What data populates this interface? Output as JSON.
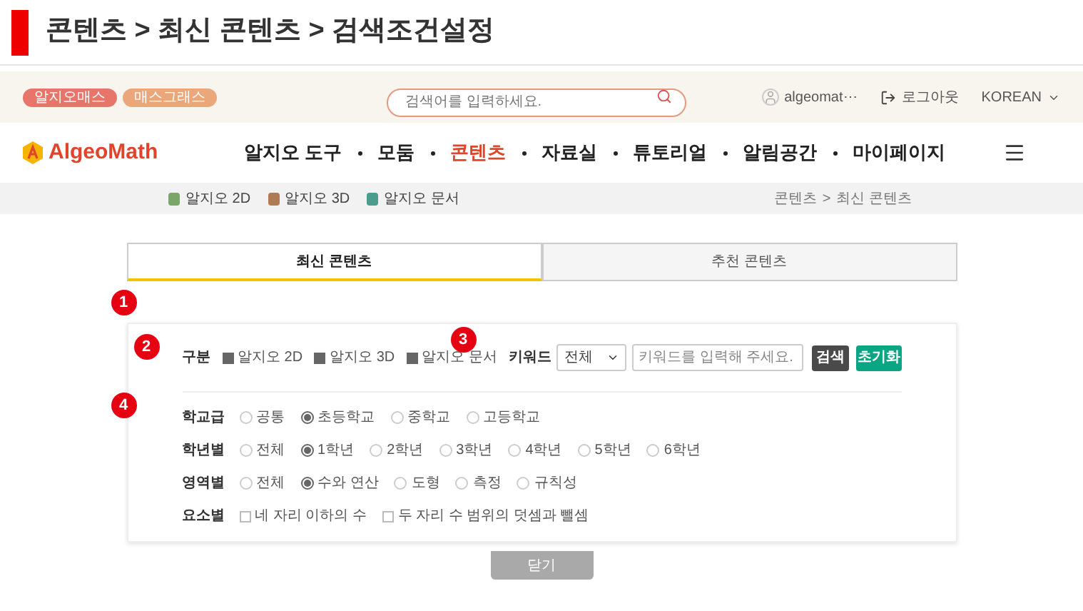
{
  "page_title": "콘텐츠 > 최신 콘텐츠 > 검색조건설정",
  "top_bar": {
    "pills": [
      {
        "label": "알지오매스",
        "color": "#e8756a"
      },
      {
        "label": "매스그래스",
        "color": "#eba77a"
      }
    ],
    "search": {
      "placeholder": "검색어를 입력하세요."
    },
    "user": "algeomat⋯",
    "logout": "로그아웃",
    "language": "KOREAN"
  },
  "nav": {
    "logo": "AlgeoMath",
    "items": [
      {
        "label": "알지오 도구",
        "selected": false
      },
      {
        "label": "모둠",
        "selected": false
      },
      {
        "label": "콘텐츠",
        "selected": true
      },
      {
        "label": "자료실",
        "selected": false
      },
      {
        "label": "튜토리얼",
        "selected": false
      },
      {
        "label": "알림공간",
        "selected": false
      },
      {
        "label": "마이페이지",
        "selected": false
      }
    ]
  },
  "sub_nav": {
    "links": [
      "알지오 2D",
      "알지오 3D",
      "알지오 문서"
    ],
    "breadcrumb": [
      "콘텐츠",
      ">",
      "최신 콘텐츠"
    ]
  },
  "tabs": [
    {
      "label": "최신 콘텐츠",
      "selected": true
    },
    {
      "label": "추천 콘텐츠",
      "selected": false
    }
  ],
  "markers": [
    "1",
    "2",
    "3",
    "4"
  ],
  "filter": {
    "category": {
      "label": "구분",
      "options": [
        {
          "label": "알지오 2D",
          "checked": true
        },
        {
          "label": "알지오 3D",
          "checked": true
        },
        {
          "label": "알지오 문서",
          "checked": true
        }
      ]
    },
    "keyword": {
      "label": "키워드",
      "select": "전체",
      "placeholder": "키워드를 입력해 주세요.",
      "search_button": "검색",
      "reset_button": "초기화"
    },
    "groups": [
      {
        "label": "학교급",
        "kind": "radio",
        "options": [
          {
            "label": "공통",
            "selected": false
          },
          {
            "label": "초등학교",
            "selected": true
          },
          {
            "label": "중학교",
            "selected": false
          },
          {
            "label": "고등학교",
            "selected": false
          }
        ]
      },
      {
        "label": "학년별",
        "kind": "radio",
        "options": [
          {
            "label": "전체",
            "selected": false
          },
          {
            "label": "1학년",
            "selected": true
          },
          {
            "label": "2학년",
            "selected": false
          },
          {
            "label": "3학년",
            "selected": false
          },
          {
            "label": "4학년",
            "selected": false
          },
          {
            "label": "5학년",
            "selected": false
          },
          {
            "label": "6학년",
            "selected": false
          }
        ]
      },
      {
        "label": "영역별",
        "kind": "radio",
        "options": [
          {
            "label": "전체",
            "selected": false
          },
          {
            "label": "수와 연산",
            "selected": true
          },
          {
            "label": "도형",
            "selected": false
          },
          {
            "label": "측정",
            "selected": false
          },
          {
            "label": "규칙성",
            "selected": false
          }
        ]
      },
      {
        "label": "요소별",
        "kind": "checkbox",
        "options": [
          {
            "label": "네 자리 이하의 수",
            "checked": false
          },
          {
            "label": "두 자리 수 범위의 덧셈과 뺄셈",
            "checked": false
          }
        ]
      }
    ]
  },
  "close_button": "닫기"
}
